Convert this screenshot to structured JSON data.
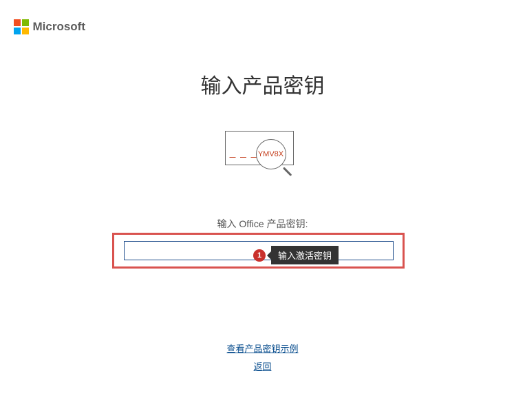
{
  "logo": {
    "text": "Microsoft"
  },
  "title": "输入产品密钥",
  "illustration": {
    "sample_key": "YMV8X",
    "dashes": "— — —"
  },
  "input": {
    "label": "输入 Office 产品密钥:",
    "value": ""
  },
  "annotation": {
    "badge": "1",
    "tooltip": "输入激活密钥"
  },
  "links": {
    "example": "查看产品密钥示例",
    "back": "返回"
  }
}
